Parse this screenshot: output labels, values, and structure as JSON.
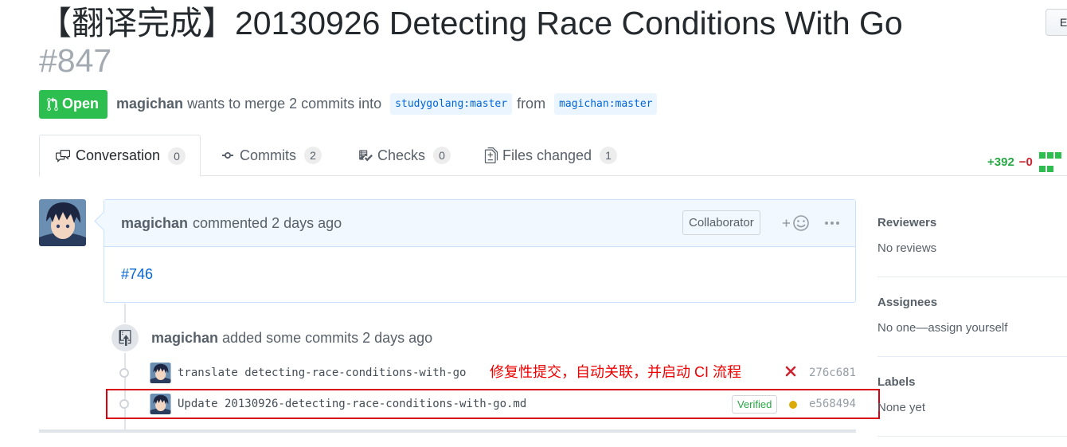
{
  "title": {
    "text": "【翻译完成】20130926 Detecting Race Conditions With Go",
    "number": "#847"
  },
  "header": {
    "edit_label": "Edit"
  },
  "state": {
    "badge": "Open",
    "author": "magichan",
    "merge_text": "wants to merge 2 commits into",
    "base_branch": "studygolang:master",
    "from_text": "from",
    "head_branch": "magichan:master"
  },
  "tabs": [
    {
      "label": "Conversation",
      "count": "0",
      "icon": "comment-discussion-icon"
    },
    {
      "label": "Commits",
      "count": "2",
      "icon": "git-commit-icon"
    },
    {
      "label": "Checks",
      "count": "0",
      "icon": "checklist-icon"
    },
    {
      "label": "Files changed",
      "count": "1",
      "icon": "file-diff-icon"
    }
  ],
  "diffstat": {
    "additions": "+392",
    "deletions": "−0"
  },
  "comment": {
    "author": "magichan",
    "action": "commented 2 days ago",
    "badge": "Collaborator",
    "body_link": "#746"
  },
  "push_event": {
    "author": "magichan",
    "text": "added some commits 2 days ago"
  },
  "commits": [
    {
      "message": "translate detecting-race-conditions-with-go",
      "sha": "276c681",
      "status": "failure",
      "annotation": "修复性提交，自动关联，并启动  CI 流程"
    },
    {
      "message": "Update 20130926-detecting-race-conditions-with-go.md",
      "sha": "e568494",
      "status": "pending",
      "verified": "Verified"
    }
  ],
  "sidebar": {
    "reviewers": {
      "title": "Reviewers",
      "value": "No reviews"
    },
    "assignees": {
      "title": "Assignees",
      "value": "No one—assign yourself"
    },
    "labels": {
      "title": "Labels",
      "value": "None yet"
    }
  },
  "colors": {
    "open_green": "#2cbe4e",
    "link_blue": "#0366d6",
    "annotation_red": "#e00000",
    "failure_red": "#cb2431",
    "pending_yellow": "#dbab09"
  }
}
